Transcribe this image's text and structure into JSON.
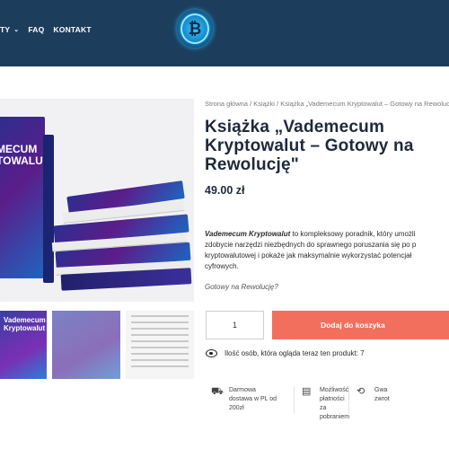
{
  "header": {
    "nav": [
      {
        "label": "TY",
        "has_dropdown": true
      },
      {
        "label": "FAQ",
        "has_dropdown": false
      },
      {
        "label": "KONTAKT",
        "has_dropdown": false
      }
    ],
    "logo_glyph": "₿"
  },
  "gallery": {
    "main_book_title": "MECUM\nTOWALUT",
    "thumb_1_title": "Vademecum\nKryptowalut"
  },
  "product": {
    "breadcrumb": [
      "Strona główna",
      "Książki",
      "Książka „Vademecum Kryptowalut – Gotowy na Rewolucję”"
    ],
    "title": "Książka „Vademecum Kryptowalut – Gotowy na Rewolucję\"",
    "price": "49.00 zł",
    "description": {
      "bold": "Vademecum Kryptowalut",
      "line1_rest": " to kompleksowy poradnik, który umożli",
      "line2": "zdobycie narzędzi niezbędnych do sprawnego poruszania się po p",
      "line3": "kryptowalutowej i pokaże jak maksymalnie wykorzystać potencjał",
      "line4": "cyfrowych."
    },
    "tagline": "Gotowy na Rewolucję?",
    "quantity": "1",
    "add_to_cart": "Dodaj do koszyka",
    "viewers_text": "Ilość osób, która ogląda teraz ten produkt: 7"
  },
  "features": [
    {
      "icon": "truck-icon",
      "glyph": "⛟",
      "text": "Darmowa\ndostawa w PL od\n200zł"
    },
    {
      "icon": "cash-icon",
      "glyph": "▤",
      "text": "Możliwość płatności\nza pobraniem"
    },
    {
      "icon": "return-icon",
      "glyph": "⟲",
      "text": "Gwa\nzwrot"
    }
  ],
  "colors": {
    "header_bg": "#1d3d5c",
    "accent_button": "#f26f5e"
  }
}
